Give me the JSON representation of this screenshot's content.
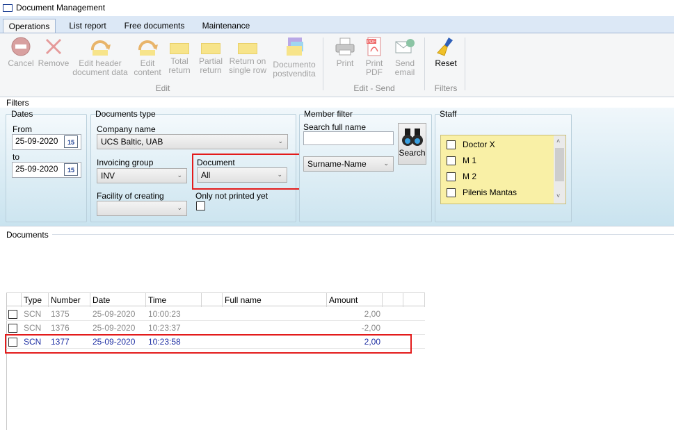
{
  "window": {
    "title": "Document Management"
  },
  "tabs": [
    {
      "label": "Operations"
    },
    {
      "label": "List report"
    },
    {
      "label": "Free documents"
    },
    {
      "label": "Maintenance"
    }
  ],
  "ribbon": {
    "edit_group": {
      "label": "Edit",
      "buttons": {
        "cancel": "Cancel",
        "remove": "Remove",
        "edit_header_1": "Edit header",
        "edit_header_2": "document data",
        "edit_content_1": "Edit",
        "edit_content_2": "content",
        "total_return_1": "Total",
        "total_return_2": "return",
        "partial_return_1": "Partial",
        "partial_return_2": "return",
        "return_single_1": "Return on",
        "return_single_2": "single row",
        "documento_1": "Documento",
        "documento_2": "postvendita"
      }
    },
    "send_group": {
      "label": "Edit - Send",
      "buttons": {
        "print": "Print",
        "print_pdf_1": "Print",
        "print_pdf_2": "PDF",
        "send_email_1": "Send",
        "send_email_2": "email"
      }
    },
    "filters_group": {
      "label": "Filters",
      "buttons": {
        "reset": "Reset"
      }
    },
    "pdf_badge": "PDF"
  },
  "filters": {
    "section_label": "Filters",
    "dates": {
      "title": "Dates",
      "from_label": "From",
      "from_value": "25-09-2020",
      "to_label": "to",
      "to_value": "25-09-2020",
      "calendar_day": "15"
    },
    "documents_type": {
      "title": "Documents type",
      "company_label": "Company name",
      "company_value": "UCS Baltic, UAB",
      "invoicing_label": "Invoicing group",
      "invoicing_value": "INV",
      "document_label": "Document",
      "document_value": "All",
      "facility_label": "Facility of creating",
      "facility_value": "",
      "not_printed_label": "Only not printed yet"
    },
    "member": {
      "title": "Member filter",
      "search_label": "Search full name",
      "search_value": "",
      "order_value": "Surname-Name",
      "search_button": "Search"
    },
    "staff": {
      "title": "Staff",
      "items": [
        "Doctor X",
        "M 1",
        "M 2",
        "Pilenis Mantas"
      ]
    }
  },
  "documents": {
    "section_label": "Documents",
    "columns": [
      "Type",
      "Number",
      "Date",
      "Time",
      "",
      "Full name",
      "Amount",
      "",
      ""
    ],
    "rows": [
      {
        "type": "SCN",
        "number": "1375",
        "date": "25-09-2020",
        "time": "10:00:23",
        "full_name": "",
        "amount": "2,00"
      },
      {
        "type": "SCN",
        "number": "1376",
        "date": "25-09-2020",
        "time": "10:23:37",
        "full_name": "",
        "amount": "-2,00"
      },
      {
        "type": "SCN",
        "number": "1377",
        "date": "25-09-2020",
        "time": "10:23:58",
        "full_name": "",
        "amount": "2,00"
      }
    ]
  },
  "colors": {
    "highlight_border": "#e31b1b",
    "selected_row_text": "#1e2fa3",
    "staff_list_bg": "#f9f0a6"
  }
}
